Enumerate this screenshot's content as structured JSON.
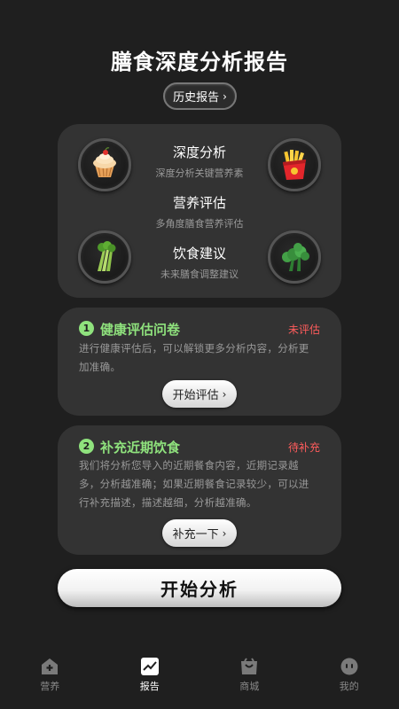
{
  "header": {
    "title": "膳食深度分析报告",
    "history_label": "历史报告"
  },
  "features": [
    {
      "title": "深度分析",
      "subtitle": "深度分析关键营养素"
    },
    {
      "title": "营养评估",
      "subtitle": "多角度膳食营养评估"
    },
    {
      "title": "饮食建议",
      "subtitle": "未来膳食调整建议"
    }
  ],
  "food_icons": [
    "cupcake-icon",
    "fries-icon",
    "celery-icon",
    "broccoli-icon"
  ],
  "tasks": [
    {
      "number": "1",
      "title": "健康评估问卷",
      "status": "未评估",
      "desc_line1": "进行健康评估后，可以解锁更多分析内容，分析更",
      "desc_line2": "加准确。",
      "button": "开始评估"
    },
    {
      "number": "2",
      "title": "补充近期饮食",
      "status": "待补充",
      "desc_line1": "我们将分析您导入的近期餐食内容，近期记录越",
      "desc_line2": "多，分析越准确；如果近期餐食记录较少，可以进",
      "desc_line3": "行补充描述，描述越细，分析越准确。",
      "button": "补充一下"
    }
  ],
  "start_button": "开始分析",
  "tabbar": [
    {
      "label": "营养",
      "icon": "home-plus-icon"
    },
    {
      "label": "报告",
      "icon": "chart-icon",
      "active": true
    },
    {
      "label": "商城",
      "icon": "shop-bag-icon"
    },
    {
      "label": "我的",
      "icon": "face-icon"
    }
  ],
  "colors": {
    "background": "#1f1f1f",
    "card": "#333333",
    "accent_green": "#8fe27d",
    "status_red": "#ff5c5c"
  }
}
